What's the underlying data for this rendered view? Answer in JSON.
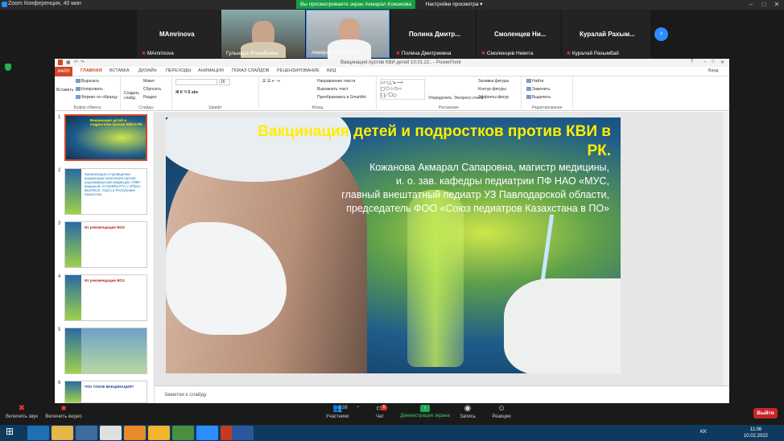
{
  "zoom": {
    "window_title": "Zoom Конференция, 40 мин",
    "share_banner": "Вы просматриваете экран Акмарал Кожанова",
    "view_settings": "Настройки просмотра ▾",
    "participants": [
      {
        "name": "MAmrinova",
        "label": "MAmrinova"
      },
      {
        "name": "",
        "label": "Гульнара Жанабаева"
      },
      {
        "name": "",
        "label": "Акмарал Кожанова"
      },
      {
        "name": "Полина Дмитр...",
        "label": "Полина Дмитриевна"
      },
      {
        "name": "Смоленцев Ни...",
        "label": "Смоленцев Никита"
      },
      {
        "name": "Куралай Рахым...",
        "label": "Куралай Рахымбай"
      }
    ],
    "toolbar": {
      "audio": "Включить звук",
      "video": "Включить видео",
      "participants": "Участники",
      "participants_count": "38",
      "chat": "Чат",
      "chat_badge": "5",
      "share": "Демонстрация экрана",
      "record": "Запись",
      "reactions": "Реакции",
      "leave": "Выйти"
    }
  },
  "ppt": {
    "title": "Вакцинация против КВИ детей 10.01.22.. - PowerPoint",
    "tabs": [
      "ФАЙЛ",
      "ГЛАВНАЯ",
      "ВСТАВКА",
      "ДИЗАЙН",
      "ПЕРЕХОДЫ",
      "АНИМАЦИЯ",
      "ПОКАЗ СЛАЙДОВ",
      "РЕЦЕНЗИРОВАНИЕ",
      "ВИД"
    ],
    "sign_in": "Вход",
    "ribbon": {
      "paste": "Вставить",
      "cut": "Вырезать",
      "copy": "Копировать",
      "format_painter": "Формат по образцу",
      "clipboard": "Буфер обмена",
      "new_slide": "Создать слайд",
      "layout": "Макет",
      "reset": "Сбросить",
      "section": "Раздел",
      "slides": "Слайды",
      "font": "Шрифт",
      "text_dir": "Направление текста",
      "align_text": "Выровнять текст",
      "smartart": "Преобразовать в SmartArt",
      "paragraph": "Абзац",
      "arrange": "Упорядочить",
      "quick_styles": "Экспресс-стили",
      "drawing": "Рисование",
      "shape_fill": "Заливка фигуры",
      "shape_outline": "Контур фигуры",
      "shape_effects": "Эффекты фигур",
      "find": "Найти",
      "replace": "Заменить",
      "select": "Выделить",
      "editing": "Редактирование",
      "font_size": "16"
    },
    "thumbs": [
      {
        "num": "1",
        "text": "Вакцинация детей и подростков против КВИ в РК"
      },
      {
        "num": "2",
        "text": "Организация и проведение вакцинации населения против коронавирусной инфекции «ПФК-вакциной «COMIRNATY»» (Pfizer-BioNTech, США) в Республике Казахстан"
      },
      {
        "num": "3",
        "text": "Из рекомендации ВОЗ"
      },
      {
        "num": "4",
        "text": "Из рекомендации ВОЗ"
      },
      {
        "num": "5",
        "text": ""
      },
      {
        "num": "6",
        "text": "ЧТО ТАКОЕ ВАКЦИНАЦИЯ?"
      }
    ],
    "slide": {
      "title": "Вакцинация детей и подростков против КВИ в РК.",
      "subtitle_lines": [
        "Кожанова Акмарал Сапаровна, магистр медицины,",
        "и. о. зав. кафедры педиатрии ПФ НАО «МУС,",
        "главный внештатный педиатр УЗ Павлодарской области,",
        "председатель ФОО «Союз педиатров Казахстана в ПО»"
      ]
    },
    "notes_placeholder": "Заметки к слайду"
  },
  "taskbar": {
    "lang": "KK",
    "time": "11:06",
    "date": "10.02.2022"
  }
}
